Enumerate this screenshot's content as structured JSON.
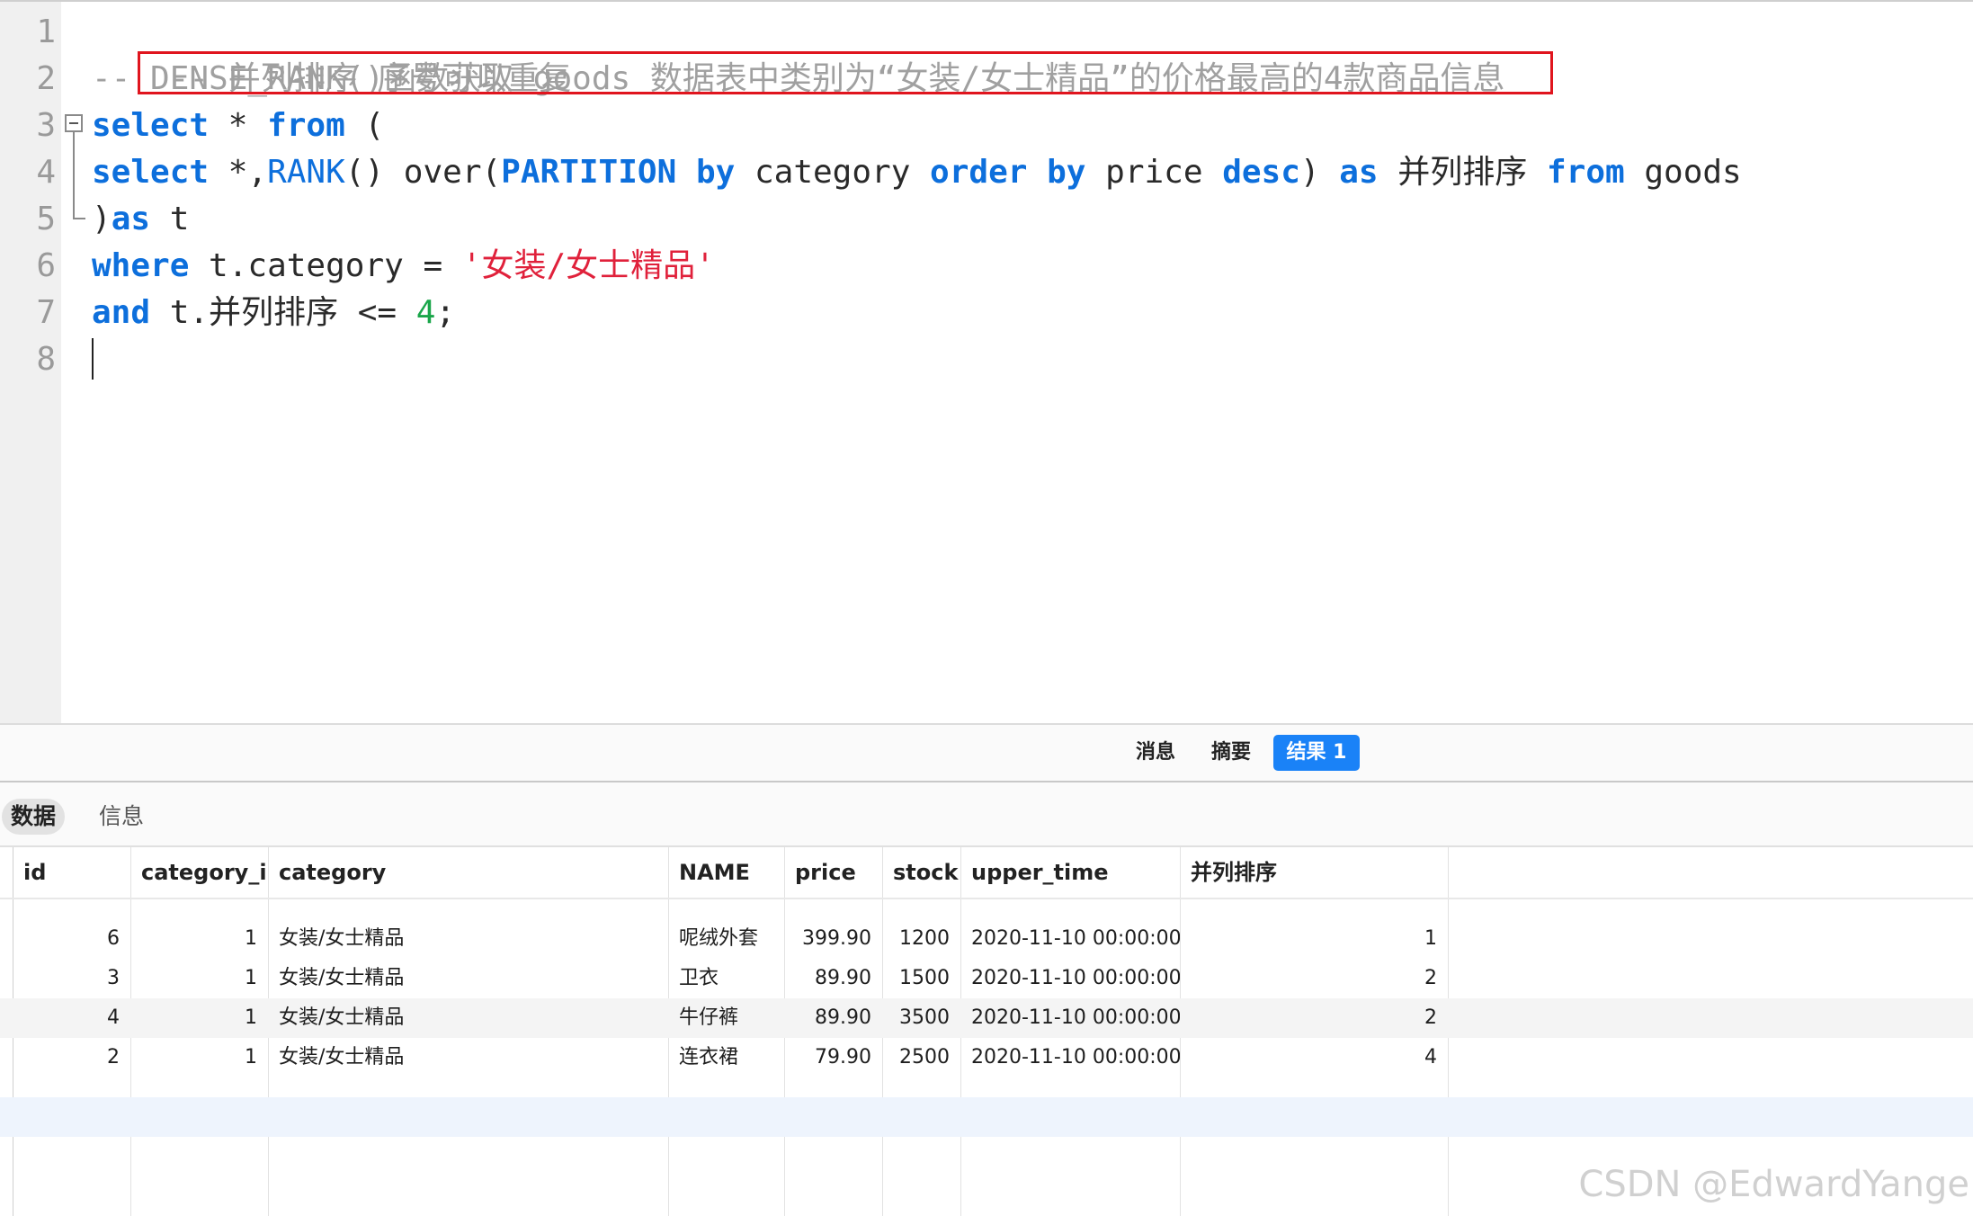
{
  "editor": {
    "line_numbers": [
      "1",
      "2",
      "3",
      "4",
      "5",
      "6",
      "7",
      "8"
    ],
    "lines": {
      "l1_comment": "-- 并列排序 序号可以重复",
      "l2_dash": "-- ",
      "l2_comment": "DENSE_RANK()函数获取 goods 数据表中类别为“女装/女士精品”的价格最高的4款商品信息",
      "l3_select": "select",
      "l3_star": " * ",
      "l3_from": "from",
      "l3_paren": " (",
      "l4_select": "select",
      "l4_star": " *,",
      "l4_rank": "RANK",
      "l4_over": "() over(",
      "l4_partition": "PARTITION",
      "l4_sp1": " ",
      "l4_by1": "by",
      "l4_category": " category ",
      "l4_order": "order",
      "l4_sp2": " ",
      "l4_by2": "by",
      "l4_price": " price ",
      "l4_desc": "desc",
      "l4_close": ") ",
      "l4_as": "as",
      "l4_alias": " 并列排序 ",
      "l4_from": "from",
      "l4_goods": " goods",
      "l5_paren": ")",
      "l5_as": "as",
      "l5_t": " t",
      "l6_where": "where",
      "l6_expr": " t.category = ",
      "l6_str": "'女装/女士精品'",
      "l7_and": "and",
      "l7_expr": " t.并列排序 <= ",
      "l7_num": "4",
      "l7_semi": ";"
    }
  },
  "result_tabs": {
    "messages": "消息",
    "summary": "摘要",
    "result1": "结果 1"
  },
  "sub_tabs": {
    "data": "数据",
    "info": "信息"
  },
  "table": {
    "columns": [
      "id",
      "category_i",
      "category",
      "NAME",
      "price",
      "stock",
      "upper_time",
      "并列排序"
    ],
    "rows": [
      [
        "6",
        "1",
        "女装/女士精品",
        "呢绒外套",
        "399.90",
        "1200",
        "2020-11-10 00:00:00",
        "1"
      ],
      [
        "3",
        "1",
        "女装/女士精品",
        "卫衣",
        "89.90",
        "1500",
        "2020-11-10 00:00:00",
        "2"
      ],
      [
        "4",
        "1",
        "女装/女士精品",
        "牛仔裤",
        "89.90",
        "3500",
        "2020-11-10 00:00:00",
        "2"
      ],
      [
        "2",
        "1",
        "女装/女士精品",
        "连衣裙",
        "79.90",
        "2500",
        "2020-11-10 00:00:00",
        "4"
      ]
    ]
  },
  "watermark": "CSDN @EdwardYange",
  "colors": {
    "keyword": "#0d6fdc",
    "string": "#e0213b",
    "number": "#1aa64a",
    "comment": "#a0a0a0",
    "highlight_box": "#e0151e",
    "active_tab": "#1a82f7"
  }
}
